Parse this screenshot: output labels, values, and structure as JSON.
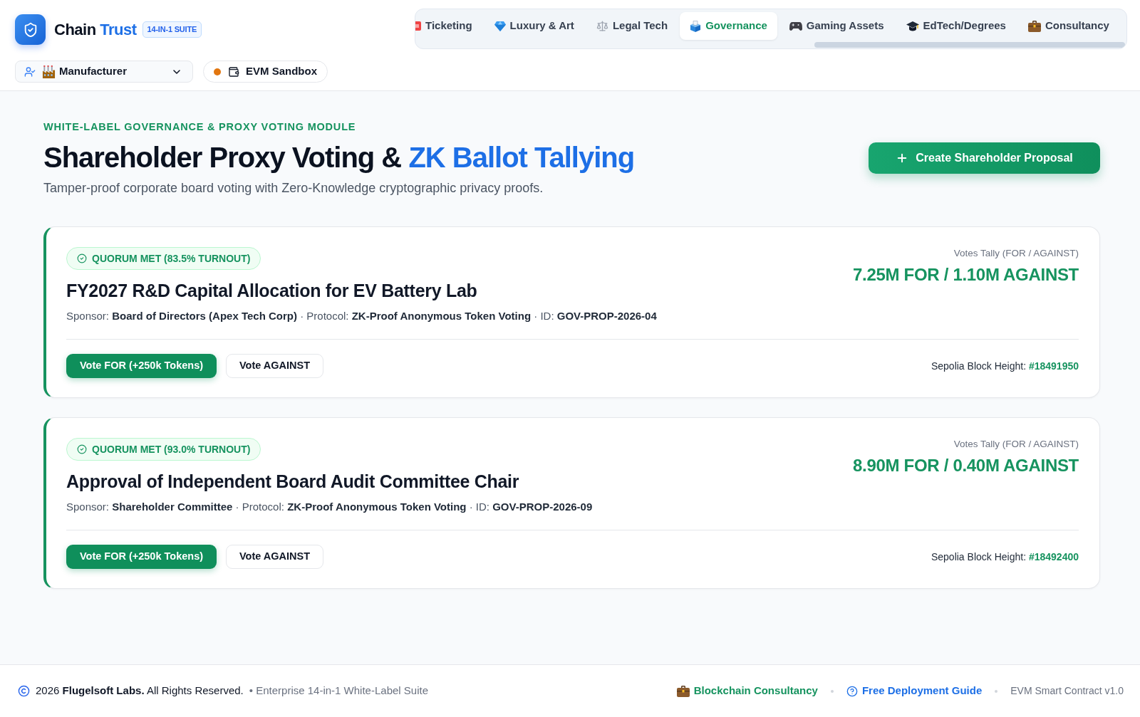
{
  "brand": {
    "name": "Chain",
    "accent": "Trust",
    "badge": "14-IN-1 SUITE"
  },
  "tabs": [
    {
      "label": "Ticketing",
      "selected": false
    },
    {
      "label": "Luxury & Art",
      "selected": false
    },
    {
      "label": "Legal Tech",
      "selected": false
    },
    {
      "label": "Governance",
      "selected": true
    },
    {
      "label": "Gaming Assets",
      "selected": false
    },
    {
      "label": "EdTech/Degrees",
      "selected": false
    },
    {
      "label": "Consultancy",
      "selected": false
    }
  ],
  "role_select": {
    "value": "Manufacturer"
  },
  "network": {
    "label": "EVM Sandbox"
  },
  "page": {
    "eyebrow": "WHITE-LABEL GOVERNANCE & PROXY VOTING MODULE",
    "title": "Shareholder Proxy Voting &",
    "title_accent": "ZK Ballot Tallying",
    "subtitle": "Tamper-proof corporate board voting with Zero-Knowledge cryptographic privacy proofs.",
    "create_button": "Create Shareholder Proposal"
  },
  "proposals": [
    {
      "quorum": "QUORUM MET (83.5% TURNOUT)",
      "title": "FY2027 R&D Capital Allocation for EV Battery Lab",
      "meta": "Sponsor: **Board of Directors (Apex Tech Corp)** · Protocol: **ZK-Proof Anonymous Token Voting** · ID: **GOV-PROP-2026-04**",
      "tally_label": "Votes Tally (FOR / AGAINST)",
      "tally": "7.25M FOR / 1.10M AGAINST",
      "vote_for": "Vote FOR (+250k Tokens)",
      "vote_against": "Vote AGAINST",
      "block": "Sepolia Block Height: **#18491950**"
    },
    {
      "quorum": "QUORUM MET (93.0% TURNOUT)",
      "title": "Approval of Independent Board Audit Committee Chair",
      "meta": "Sponsor: **Shareholder Committee** · Protocol: **ZK-Proof Anonymous Token Voting** · ID: **GOV-PROP-2026-09**",
      "tally_label": "Votes Tally (FOR / AGAINST)",
      "tally": "8.90M FOR / 0.40M AGAINST",
      "vote_for": "Vote FOR (+250k Tokens)",
      "vote_against": "Vote AGAINST",
      "block": "Sepolia Block Height: **#18492400**"
    }
  ],
  "footer": {
    "copyright": "2026 **Flugelsoft Labs.** All Rights Reserved.",
    "edition": "• Enterprise 14-in-1 White-Label Suite",
    "consultancy_link": "Blockchain Consultancy",
    "guide_link": "Free Deployment Guide",
    "version": "EVM Smart Contract v1.0"
  }
}
